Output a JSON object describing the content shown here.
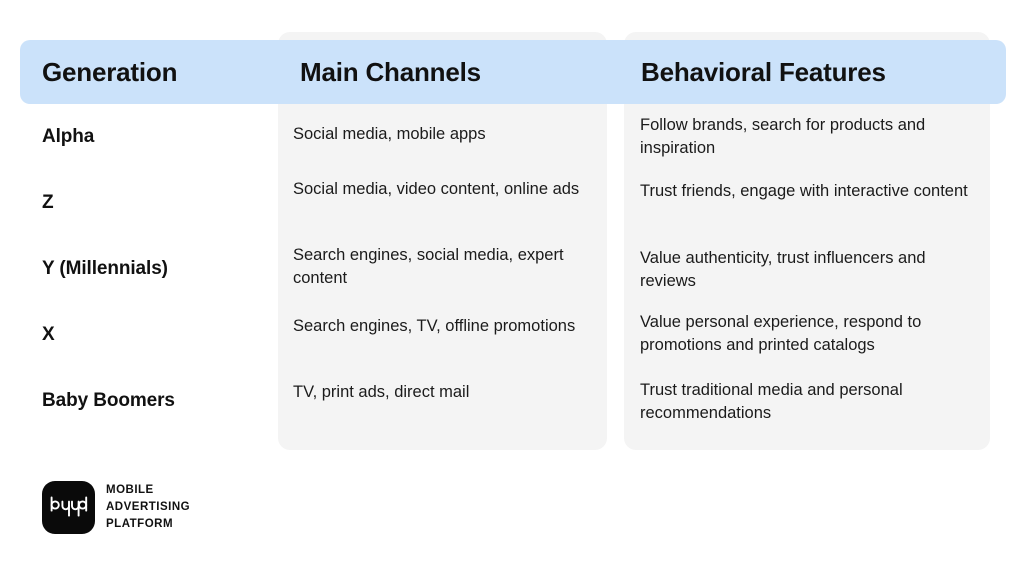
{
  "table": {
    "columns": [
      {
        "key": "generation",
        "label": "Generation"
      },
      {
        "key": "channels",
        "label": "Main Channels"
      },
      {
        "key": "behavior",
        "label": "Behavioral Features"
      }
    ],
    "rows": [
      {
        "generation": "Alpha",
        "channels": "Social media, mobile apps",
        "behavior": "Follow brands, search for products and inspiration"
      },
      {
        "generation": "Z",
        "channels": "Social media, video content, online ads",
        "behavior": "Trust friends, engage with interactive content"
      },
      {
        "generation": "Y (Millennials)",
        "channels": "Search engines, social media, expert content",
        "behavior": "Value authenticity, trust influencers and reviews"
      },
      {
        "generation": "X",
        "channels": "Search engines, TV, offline promotions",
        "behavior": "Value personal experience, respond to promotions and printed catalogs"
      },
      {
        "generation": "Baby Boomers",
        "channels": "TV, print ads, direct mail",
        "behavior": "Trust traditional media and personal recommendations"
      }
    ]
  },
  "logo": {
    "mark_wordmark": "byyd",
    "line1": "MOBILE",
    "line2": "ADVERTISING",
    "line3": "PLATFORM"
  },
  "colors": {
    "header_bar": "#cbe2fa",
    "panel_background": "#f4f4f4",
    "page_background": "#ffffff",
    "text_primary": "#111111",
    "logo_mark": "#0a0a0a"
  }
}
